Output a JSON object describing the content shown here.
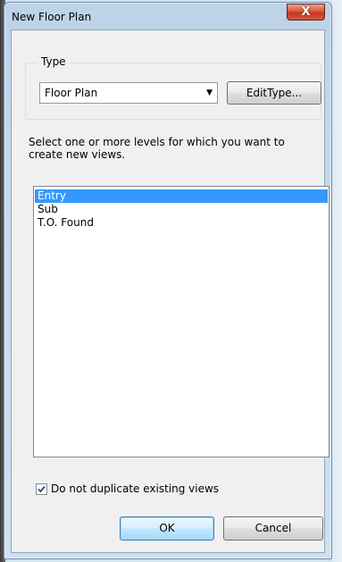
{
  "dialog": {
    "title": "New Floor Plan",
    "close_label": "X"
  },
  "type_group": {
    "label": "Type",
    "selected_type": "Floor Plan",
    "edit_type_label": "EditType..."
  },
  "instructions": "Select one or more levels for which you want to create new views.",
  "levels": {
    "items": [
      {
        "label": "Entry",
        "selected": true
      },
      {
        "label": "Sub",
        "selected": false
      },
      {
        "label": "T.O. Found",
        "selected": false
      }
    ]
  },
  "options": {
    "no_duplicate_label": "Do not duplicate existing views",
    "no_duplicate_checked": true
  },
  "buttons": {
    "ok_label": "OK",
    "cancel_label": "Cancel"
  },
  "colors": {
    "selection": "#3399ff",
    "close_button": "#c43a22",
    "window_frame": "#bcd3e8"
  },
  "icons": {
    "dropdown": "chevron-down-icon",
    "close": "close-icon",
    "check": "checkmark-icon"
  }
}
